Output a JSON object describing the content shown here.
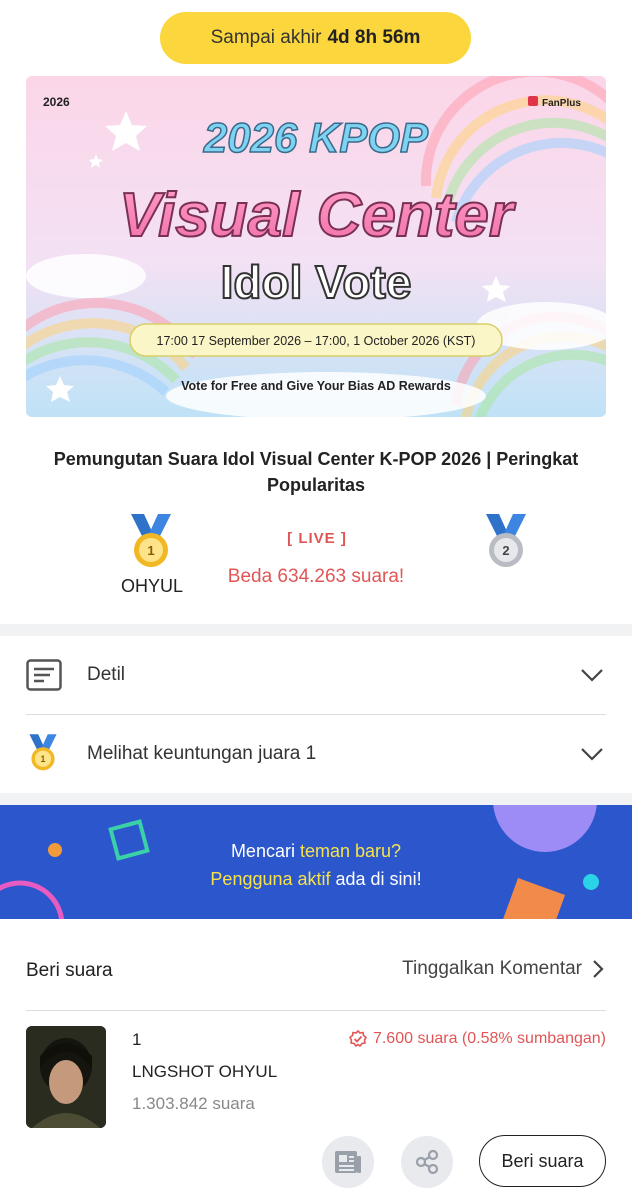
{
  "timer": {
    "label": "Sampai akhir",
    "value": "4d 8h 56m"
  },
  "banner": {
    "year": "2026",
    "brand": "FanPlus",
    "headline_line1": "2026 KPOP",
    "headline_line2": "Visual Center",
    "headline_line3": "Idol Vote",
    "period": "17:00 17 September 2026 – 17:00, 1 October 2026 (KST)",
    "tagline": "Vote for Free and Give Your Bias AD Rewards"
  },
  "page_title": "Pemungutan Suara Idol Visual Center K-POP 2026 | Peringkat Popularitas",
  "ranking": {
    "first_medal_number": "1",
    "first_name": "OHYUL",
    "live_tag": "[ LIVE ]",
    "diff_text": "Beda 634.263 suara!",
    "second_medal_number": "2"
  },
  "accordion": {
    "detail_label": "Detil",
    "reward_label": "Melihat keuntungan juara 1",
    "reward_medal_number": "1"
  },
  "ad": {
    "line1_prefix": "Mencari ",
    "line1_highlight": "teman baru?",
    "line2_highlight": "Pengguna aktif",
    "line2_suffix": " ada di sini!"
  },
  "vote_section": {
    "title": "Beri suara",
    "comment_link": "Tinggalkan Komentar"
  },
  "entry": {
    "rank": "1",
    "name": "LNGSHOT OHYUL",
    "votes": "1.303.842 suara",
    "contribution": "7.600 suara (0.58% sumbangan)",
    "vote_button": "Beri suara"
  },
  "colors": {
    "accent_yellow": "#fbd63c",
    "live_red": "#e05656",
    "ad_blue": "#2b56cc",
    "ad_highlight": "#f7e24a"
  }
}
